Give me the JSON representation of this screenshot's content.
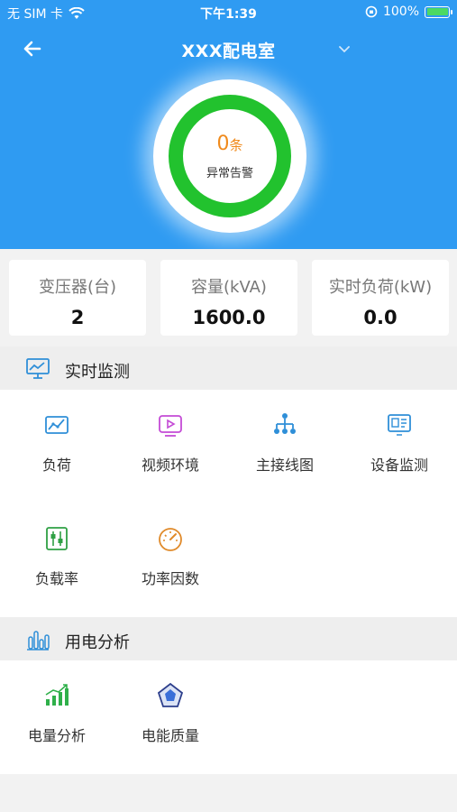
{
  "status_bar": {
    "carrier": "无 SIM 卡",
    "time": "下午1:39",
    "battery": "100%"
  },
  "header": {
    "title": "XXX配电室"
  },
  "alarm": {
    "count": "0",
    "unit": "条",
    "label": "异常告警"
  },
  "stats": [
    {
      "label": "变压器(台)",
      "value": "2"
    },
    {
      "label": "容量(kVA)",
      "value": "1600.0"
    },
    {
      "label": "实时负荷(kW)",
      "value": "0.0"
    }
  ],
  "realtime": {
    "title": "实时监测",
    "items": [
      {
        "label": "负荷",
        "icon": "load-chart-icon"
      },
      {
        "label": "视频环境",
        "icon": "video-play-icon"
      },
      {
        "label": "主接线图",
        "icon": "wiring-diagram-icon"
      },
      {
        "label": "设备监测",
        "icon": "device-monitor-icon"
      },
      {
        "label": "负载率",
        "icon": "load-rate-slider-icon"
      },
      {
        "label": "功率因数",
        "icon": "power-factor-gauge-icon"
      }
    ]
  },
  "analysis": {
    "title": "用电分析",
    "items": [
      {
        "label": "电量分析",
        "icon": "energy-trend-icon"
      },
      {
        "label": "电能质量",
        "icon": "power-quality-icon"
      }
    ]
  },
  "colors": {
    "header_blue": "#2f9bf2",
    "ring_green": "#22c22e",
    "alarm_orange": "#f08a1c"
  }
}
